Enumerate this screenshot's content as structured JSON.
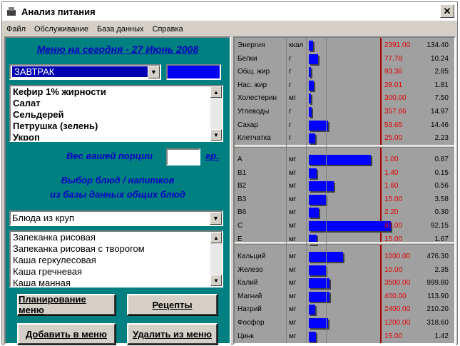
{
  "window": {
    "title": "Анализ питания",
    "close_label": "✕",
    "menu": [
      "Файл",
      "Обслуживание",
      "База данных",
      "Справка"
    ]
  },
  "left": {
    "header": "Меню на сегодня - 27 Июнь 2008",
    "meal_select": "ЗАВТРАК",
    "menu_items": [
      "Кефир 1% жирности",
      "Салат",
      "Сельдерей",
      "Петрушка (зелень)",
      "Укроп"
    ],
    "portion_label": "Вес вашей порции",
    "portion_value": "",
    "portion_unit": "гр.",
    "select_line1": "Выбор блюд / напитков",
    "select_line2": "из базы данных общих блюд",
    "category_select": "Блюда из круп",
    "dishes": [
      "Запеканка рисовая",
      "Запеканка рисовая с творогом",
      "Каша геркулесовая",
      "Каша гречневая",
      "Каша манная"
    ],
    "buttons": {
      "plan": "Планирование меню",
      "recipes": "Рецепты",
      "add": "Добавить в меню",
      "remove": "Удалить из меню"
    }
  },
  "nutrients": {
    "groups": [
      [
        {
          "name": "Энергия",
          "unit": "ккал",
          "norm": "2391.00",
          "actual": "134.40",
          "pct": 5.6
        },
        {
          "name": "Белки",
          "unit": "г",
          "norm": "77.78",
          "actual": "10.24",
          "pct": 13.2
        },
        {
          "name": "Общ. жир",
          "unit": "г",
          "norm": "93.36",
          "actual": "2.85",
          "pct": 3.1
        },
        {
          "name": "Нас. жир",
          "unit": "г",
          "norm": "28.01",
          "actual": "1.81",
          "pct": 6.5
        },
        {
          "name": "Холестерин",
          "unit": "мг",
          "norm": "300.00",
          "actual": "7.50",
          "pct": 2.5
        },
        {
          "name": "Углеводы",
          "unit": "г",
          "norm": "357.66",
          "actual": "14.97",
          "pct": 4.2
        },
        {
          "name": "Сахар",
          "unit": "г",
          "norm": "53.65",
          "actual": "14.46",
          "pct": 27.0
        },
        {
          "name": "Клетчатка",
          "unit": "г",
          "norm": "25.00",
          "actual": "2.23",
          "pct": 8.9
        }
      ],
      [
        {
          "name": "A",
          "unit": "мг",
          "norm": "1.00",
          "actual": "0.87",
          "pct": 87.0
        },
        {
          "name": "B1",
          "unit": "мг",
          "norm": "1.40",
          "actual": "0.15",
          "pct": 10.7
        },
        {
          "name": "B2",
          "unit": "мг",
          "norm": "1.60",
          "actual": "0.56",
          "pct": 35.0
        },
        {
          "name": "B3",
          "unit": "мг",
          "norm": "15.00",
          "actual": "3.58",
          "pct": 23.9
        },
        {
          "name": "B6",
          "unit": "мг",
          "norm": "2.20",
          "actual": "0.30",
          "pct": 13.6
        },
        {
          "name": "C",
          "unit": "мг",
          "norm": "80.00",
          "actual": "92.15",
          "pct": 115.2
        },
        {
          "name": "E",
          "unit": "мг",
          "norm": "15.00",
          "actual": "1.67",
          "pct": 11.1
        }
      ],
      [
        {
          "name": "Кальций",
          "unit": "мг",
          "norm": "1000.00",
          "actual": "476.30",
          "pct": 47.6
        },
        {
          "name": "Железо",
          "unit": "мг",
          "norm": "10.00",
          "actual": "2.35",
          "pct": 23.5
        },
        {
          "name": "Калий",
          "unit": "мг",
          "norm": "3500.00",
          "actual": "999.80",
          "pct": 28.6
        },
        {
          "name": "Магний",
          "unit": "мг",
          "norm": "400.00",
          "actual": "113.90",
          "pct": 28.5
        },
        {
          "name": "Натрий",
          "unit": "мг",
          "norm": "2400.00",
          "actual": "210.20",
          "pct": 8.8
        },
        {
          "name": "Фосфор",
          "unit": "мг",
          "norm": "1200.00",
          "actual": "318.60",
          "pct": 26.6
        },
        {
          "name": "Цинк",
          "unit": "мг",
          "norm": "15.00",
          "actual": "1.42",
          "pct": 9.5
        }
      ]
    ]
  }
}
